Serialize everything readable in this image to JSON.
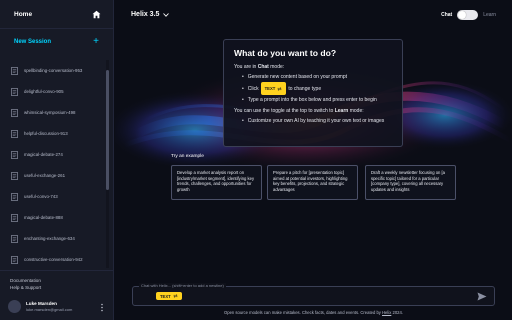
{
  "sidebar": {
    "title": "Home",
    "new_session_label": "New Session",
    "sessions": [
      "spellbinding-conversation-953",
      "delightful-convo-905",
      "whimsical-symposium-498",
      "helpful-discussion-913",
      "magical-debate-274",
      "useful-exchange-261",
      "useful-convo-743",
      "magical-debate-888",
      "enchanting-exchange-634",
      "constructive-conversation-942"
    ],
    "footer": {
      "documentation": "Documentation",
      "help": "Help & Support",
      "user_name": "Luke Marsden",
      "user_email": "luke.marsden@gmail.com"
    }
  },
  "header": {
    "model": "Helix 3.5",
    "mode_chat": "Chat",
    "mode_learn": "Learn"
  },
  "info": {
    "title": "What do you want to do?",
    "mode_prefix": "You are in ",
    "mode_name": "Chat",
    "mode_suffix": " mode:",
    "bullet1": "Generate new content based on your prompt",
    "bullet2_pre": "Click",
    "bullet2_post": "to change type",
    "bullet3": "Type a prompt into the box below and press enter to begin",
    "learn_prefix": "You can use the toggle at the top to switch to ",
    "learn_name": "Learn",
    "learn_suffix": " mode:",
    "bullet4": "Customize your own AI by teaching it your own text or images"
  },
  "chip_label": "TEXT",
  "examples": {
    "label": "Try an example",
    "items": [
      "Develop a market analysis report on [industry/market segment], identifying key trends, challenges, and opportunities for growth",
      "Prepare a pitch for [presentation topic] aimed at potential investors, highlighting key benefits, projections, and strategic advantages",
      "Draft a weekly newsletter focusing on [a specific topic] tailored for a particular [company type], covering all necessary updates and insights"
    ]
  },
  "input": {
    "placeholder": "Chat with Helix... (shift+enter to add a newline)"
  },
  "disclaimer": {
    "text": "Open source models can make mistakes. Check facts, dates and events. Created by ",
    "link": "Helix",
    "suffix": " 2024."
  },
  "colors": {
    "accent": "#00d5ff",
    "chip": "#ffd21f",
    "background": "#0b0d16",
    "sidebar": "#171a26"
  }
}
